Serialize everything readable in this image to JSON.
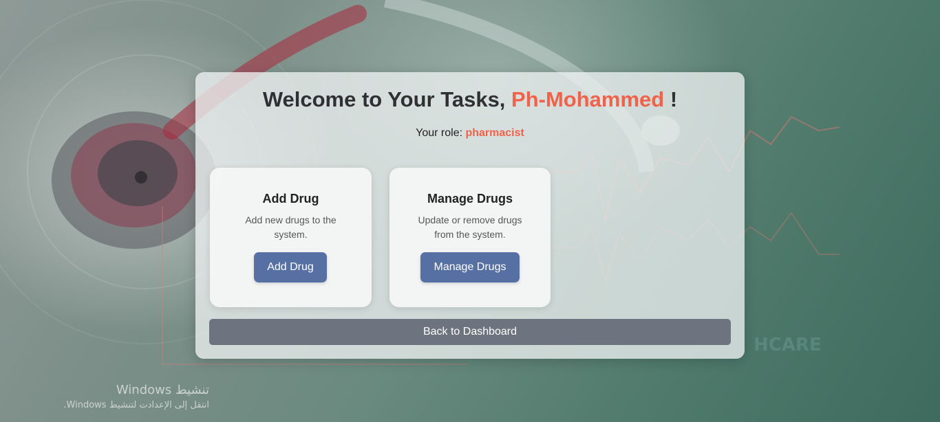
{
  "header": {
    "title_prefix": "Welcome to Your Tasks, ",
    "username": "Ph-Mohammed",
    "title_suffix": " !",
    "role_label": "Your role: ",
    "role_value": "pharmacist"
  },
  "cards": [
    {
      "title": "Add Drug",
      "description": "Add new drugs to the system.",
      "button_label": "Add Drug"
    },
    {
      "title": "Manage Drugs",
      "description": "Update or remove drugs from the system.",
      "button_label": "Manage Drugs"
    }
  ],
  "footer": {
    "back_label": "Back to Dashboard"
  },
  "background_text": "HCARE",
  "windows_activation": {
    "title": "تنشيط Windows",
    "subtitle": "انتقل إلى الإعدادت لتنشيط Windows."
  },
  "colors": {
    "accent": "#f0624a",
    "primary_button": "#5670a3",
    "secondary_button": "#6d7480"
  }
}
